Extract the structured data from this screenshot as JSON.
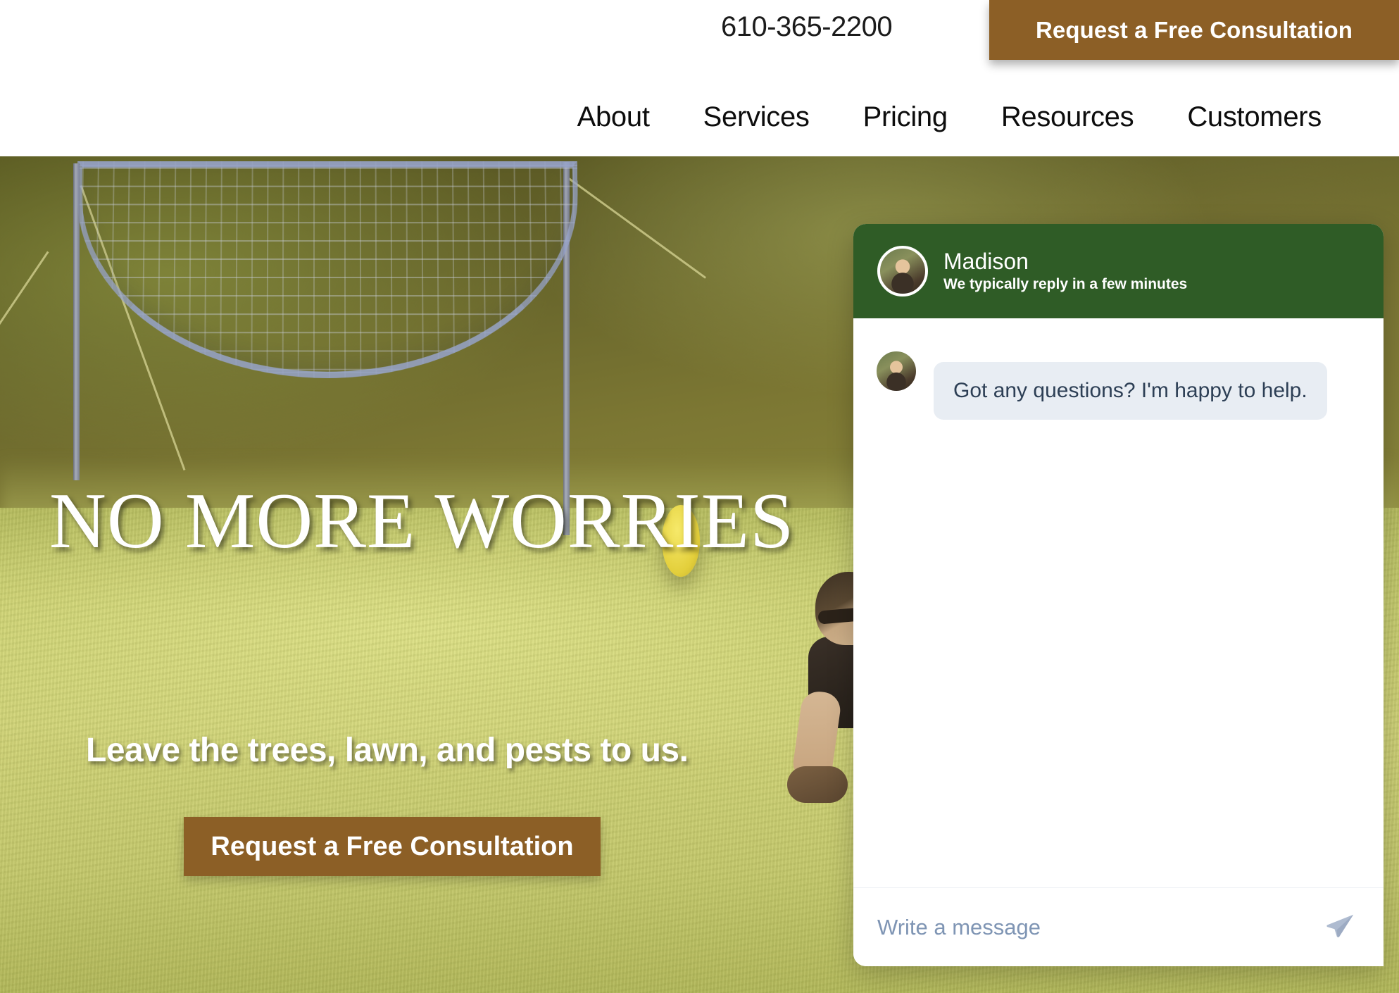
{
  "header": {
    "phone": "610-365-2200",
    "cta_label": "Request a Free Consultation",
    "nav": [
      {
        "label": "About"
      },
      {
        "label": "Services"
      },
      {
        "label": "Pricing"
      },
      {
        "label": "Resources"
      },
      {
        "label": "Customers"
      }
    ]
  },
  "hero": {
    "title": "NO MORE WORRIES",
    "subtitle": "Leave the trees, lawn, and pests to us.",
    "cta_label": "Request a Free Consultation"
  },
  "chat": {
    "agent_name": "Madison",
    "agent_status": "We typically reply in a few minutes",
    "messages": [
      {
        "from": "agent",
        "text": "Got any questions? I'm happy to help."
      }
    ],
    "input_placeholder": "Write a message",
    "input_value": "",
    "send_icon": "paper-plane-icon",
    "avatar_icon": "agent-avatar"
  },
  "colors": {
    "brand_brown": "#8c5f26",
    "brand_green": "#2f5c26",
    "bubble_gray": "#e8edf3",
    "bubble_text": "#2d3f55",
    "placeholder": "#7f95b4",
    "send_icon": "#aebbd0"
  }
}
